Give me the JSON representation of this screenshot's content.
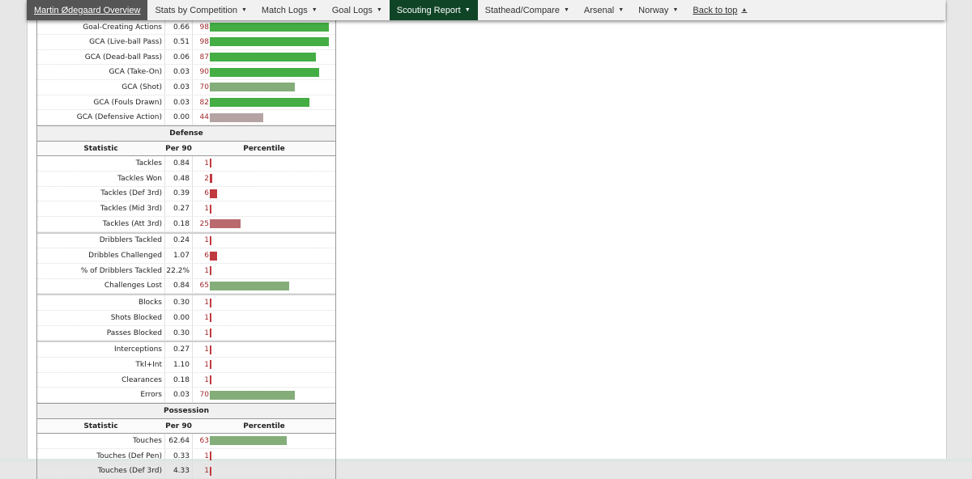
{
  "nav": {
    "items": [
      {
        "label": "Martin Ødegaard Overview",
        "caret": "",
        "type": "overview"
      },
      {
        "label": "Stats by Competition",
        "caret": "▼",
        "type": ""
      },
      {
        "label": "Match Logs",
        "caret": "▼",
        "type": ""
      },
      {
        "label": "Goal Logs",
        "caret": "▼",
        "type": ""
      },
      {
        "label": "Scouting Report",
        "caret": "▼",
        "type": "active"
      },
      {
        "label": "Stathead/Compare",
        "caret": "▼",
        "type": ""
      },
      {
        "label": "Arsenal",
        "caret": "▼",
        "type": ""
      },
      {
        "label": "Norway",
        "caret": "▼",
        "type": ""
      },
      {
        "label": "Back to top",
        "caret": "▲",
        "type": "backtop"
      }
    ]
  },
  "colors": {
    "elite": "#44ad44",
    "good": "#84ad7a",
    "average": "#b5a3a4",
    "poor": "#ba6a6e",
    "bad": "#c0393e"
  },
  "columns": {
    "statistic": "Statistic",
    "per90": "Per 90",
    "percentile": "Percentile"
  },
  "gca_rows": [
    {
      "stat": "Goal-Creating Actions",
      "value": "0.66",
      "pct": 98
    },
    {
      "stat": "GCA (Live-ball Pass)",
      "value": "0.51",
      "pct": 98
    },
    {
      "stat": "GCA (Dead-ball Pass)",
      "value": "0.06",
      "pct": 87
    },
    {
      "stat": "GCA (Take-On)",
      "value": "0.03",
      "pct": 90
    },
    {
      "stat": "GCA (Shot)",
      "value": "0.03",
      "pct": 70
    },
    {
      "stat": "GCA (Fouls Drawn)",
      "value": "0.03",
      "pct": 82
    },
    {
      "stat": "GCA (Defensive Action)",
      "value": "0.00",
      "pct": 44
    }
  ],
  "defense": {
    "title": "Defense",
    "groups": [
      [
        {
          "stat": "Tackles",
          "value": "0.84",
          "pct": 1
        },
        {
          "stat": "Tackles Won",
          "value": "0.48",
          "pct": 2
        },
        {
          "stat": "Tackles (Def 3rd)",
          "value": "0.39",
          "pct": 6
        },
        {
          "stat": "Tackles (Mid 3rd)",
          "value": "0.27",
          "pct": 1
        },
        {
          "stat": "Tackles (Att 3rd)",
          "value": "0.18",
          "pct": 25
        }
      ],
      [
        {
          "stat": "Dribblers Tackled",
          "value": "0.24",
          "pct": 1
        },
        {
          "stat": "Dribbles Challenged",
          "value": "1.07",
          "pct": 6
        },
        {
          "stat": "% of Dribblers Tackled",
          "value": "22.2%",
          "pct": 1
        },
        {
          "stat": "Challenges Lost",
          "value": "0.84",
          "pct": 65
        }
      ],
      [
        {
          "stat": "Blocks",
          "value": "0.30",
          "pct": 1
        },
        {
          "stat": "Shots Blocked",
          "value": "0.00",
          "pct": 1
        },
        {
          "stat": "Passes Blocked",
          "value": "0.30",
          "pct": 1
        }
      ],
      [
        {
          "stat": "Interceptions",
          "value": "0.27",
          "pct": 1
        },
        {
          "stat": "Tkl+Int",
          "value": "1.10",
          "pct": 1
        },
        {
          "stat": "Clearances",
          "value": "0.18",
          "pct": 1
        },
        {
          "stat": "Errors",
          "value": "0.03",
          "pct": 70
        }
      ]
    ]
  },
  "possession": {
    "title": "Possession",
    "rows": [
      {
        "stat": "Touches",
        "value": "62.64",
        "pct": 63
      },
      {
        "stat": "Touches (Def Pen)",
        "value": "0.33",
        "pct": 1
      },
      {
        "stat": "Touches (Def 3rd)",
        "value": "4.33",
        "pct": 1
      }
    ]
  }
}
